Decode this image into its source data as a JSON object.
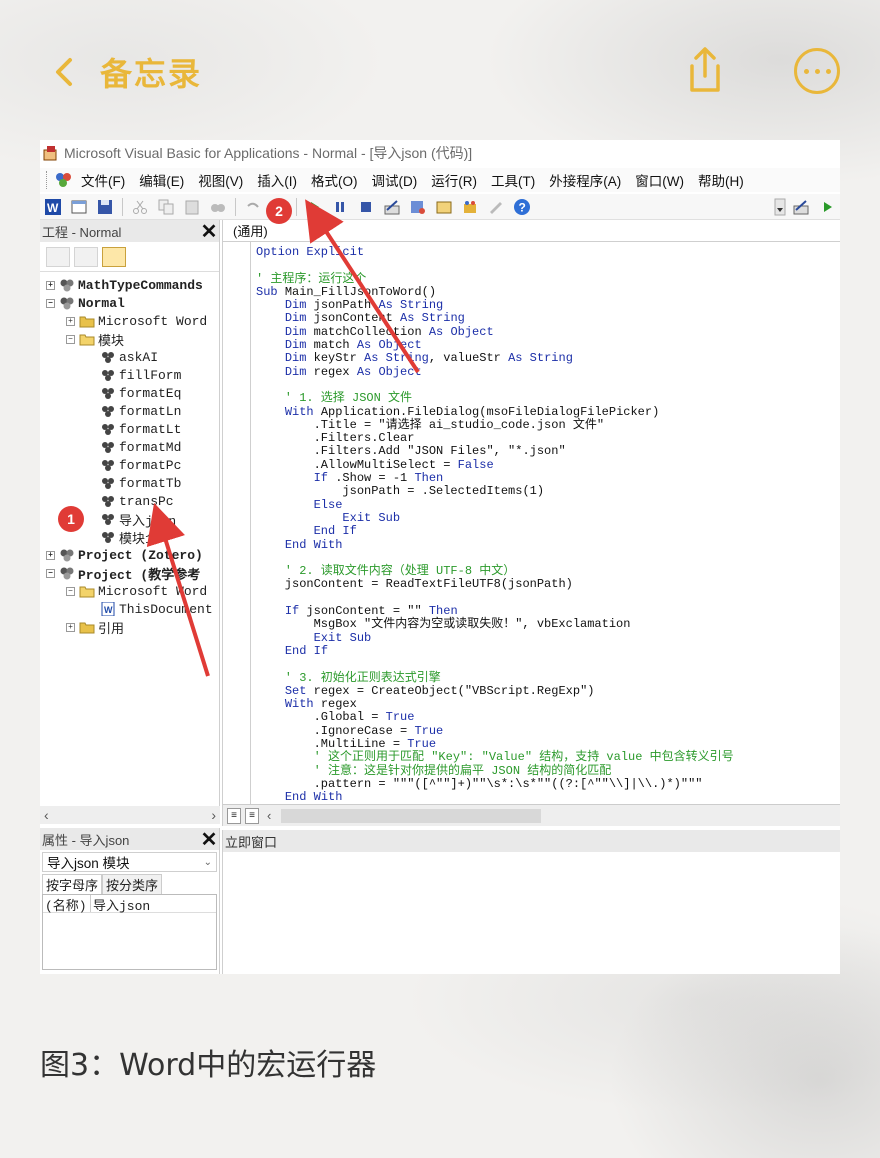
{
  "nav": {
    "back_label": "备忘录",
    "accent_color": "#e9b73a",
    "share_icon": "share-icon",
    "more_icon": "more-icon"
  },
  "vba": {
    "title": "Microsoft Visual Basic for Applications - Normal - [导入json (代码)]",
    "menu": [
      "文件(F)",
      "编辑(E)",
      "视图(V)",
      "插入(I)",
      "格式(O)",
      "调试(D)",
      "运行(R)",
      "工具(T)",
      "外接程序(A)",
      "窗口(W)",
      "帮助(H)"
    ],
    "project_panel": {
      "title": "工程 - Normal",
      "tree": [
        {
          "label": "MathTypeCommands",
          "bold": true
        },
        {
          "label": "Normal",
          "bold": true
        },
        {
          "label": "Microsoft Word",
          "bold": false
        },
        {
          "label": "模块",
          "bold": false
        },
        {
          "label": "askAI"
        },
        {
          "label": "fillForm"
        },
        {
          "label": "formatEq"
        },
        {
          "label": "formatLn"
        },
        {
          "label": "formatLt"
        },
        {
          "label": "formatMd"
        },
        {
          "label": "formatPc"
        },
        {
          "label": "formatTb"
        },
        {
          "label": "transPc"
        },
        {
          "label": "导入json"
        },
        {
          "label": "模块1"
        },
        {
          "label": "Project (Zotero)",
          "bold": true
        },
        {
          "label": "Project (教学参考",
          "bold": true
        },
        {
          "label": "Microsoft Word"
        },
        {
          "label": "ThisDocument"
        },
        {
          "label": "引用"
        }
      ]
    },
    "props_panel": {
      "title": "属性 - 导入json",
      "selected": "导入json 模块",
      "tabs": [
        "按字母序",
        "按分类序"
      ],
      "row_name": "(名称)",
      "row_value": "导入json"
    },
    "code_panel": {
      "combo": "(通用)",
      "lines": [
        [
          {
            "t": "Option Explicit",
            "c": "kw"
          }
        ],
        [
          {
            "t": ""
          }
        ],
        [
          {
            "t": "' 主程序：运行这个",
            "c": "cm"
          }
        ],
        [
          {
            "t": "Sub ",
            "c": "kw"
          },
          {
            "t": "Main_FillJsonToWord()"
          }
        ],
        [
          {
            "t": "    "
          },
          {
            "t": "Dim ",
            "c": "kw"
          },
          {
            "t": "jsonPath "
          },
          {
            "t": "As String",
            "c": "kw"
          }
        ],
        [
          {
            "t": "    "
          },
          {
            "t": "Dim ",
            "c": "kw"
          },
          {
            "t": "jsonContent "
          },
          {
            "t": "As String",
            "c": "kw"
          }
        ],
        [
          {
            "t": "    "
          },
          {
            "t": "Dim ",
            "c": "kw"
          },
          {
            "t": "matchCollection "
          },
          {
            "t": "As Object",
            "c": "kw"
          }
        ],
        [
          {
            "t": "    "
          },
          {
            "t": "Dim ",
            "c": "kw"
          },
          {
            "t": "match "
          },
          {
            "t": "As Object",
            "c": "kw"
          }
        ],
        [
          {
            "t": "    "
          },
          {
            "t": "Dim ",
            "c": "kw"
          },
          {
            "t": "keyStr "
          },
          {
            "t": "As String",
            "c": "kw"
          },
          {
            "t": ", valueStr "
          },
          {
            "t": "As String",
            "c": "kw"
          }
        ],
        [
          {
            "t": "    "
          },
          {
            "t": "Dim ",
            "c": "kw"
          },
          {
            "t": "regex "
          },
          {
            "t": "As Object",
            "c": "kw"
          }
        ],
        [
          {
            "t": ""
          }
        ],
        [
          {
            "t": "    ' 1. 选择 JSON 文件",
            "c": "cm"
          }
        ],
        [
          {
            "t": "    "
          },
          {
            "t": "With ",
            "c": "kw"
          },
          {
            "t": "Application.FileDialog(msoFileDialogFilePicker)"
          }
        ],
        [
          {
            "t": "        .Title = \"请选择 ai_studio_code.json 文件\""
          }
        ],
        [
          {
            "t": "        .Filters.Clear"
          }
        ],
        [
          {
            "t": "        .Filters.Add \"JSON Files\", \"*.json\""
          }
        ],
        [
          {
            "t": "        .AllowMultiSelect = "
          },
          {
            "t": "False",
            "c": "kw"
          }
        ],
        [
          {
            "t": "        "
          },
          {
            "t": "If ",
            "c": "kw"
          },
          {
            "t": ".Show = -1 "
          },
          {
            "t": "Then",
            "c": "kw"
          }
        ],
        [
          {
            "t": "            jsonPath = .SelectedItems(1)"
          }
        ],
        [
          {
            "t": "        "
          },
          {
            "t": "Else",
            "c": "kw"
          }
        ],
        [
          {
            "t": "            "
          },
          {
            "t": "Exit Sub",
            "c": "kw"
          }
        ],
        [
          {
            "t": "        "
          },
          {
            "t": "End If",
            "c": "kw"
          }
        ],
        [
          {
            "t": "    "
          },
          {
            "t": "End With",
            "c": "kw"
          }
        ],
        [
          {
            "t": ""
          }
        ],
        [
          {
            "t": "    ' 2. 读取文件内容（处理 UTF-8 中文）",
            "c": "cm"
          }
        ],
        [
          {
            "t": "    jsonContent = ReadTextFileUTF8(jsonPath)"
          }
        ],
        [
          {
            "t": ""
          }
        ],
        [
          {
            "t": "    "
          },
          {
            "t": "If ",
            "c": "kw"
          },
          {
            "t": "jsonContent = \"\" "
          },
          {
            "t": "Then",
            "c": "kw"
          }
        ],
        [
          {
            "t": "        MsgBox \"文件内容为空或读取失败！\", vbExclamation"
          }
        ],
        [
          {
            "t": "        "
          },
          {
            "t": "Exit Sub",
            "c": "kw"
          }
        ],
        [
          {
            "t": "    "
          },
          {
            "t": "End If",
            "c": "kw"
          }
        ],
        [
          {
            "t": ""
          }
        ],
        [
          {
            "t": "    ' 3. 初始化正则表达式引擎",
            "c": "cm"
          }
        ],
        [
          {
            "t": "    "
          },
          {
            "t": "Set ",
            "c": "kw"
          },
          {
            "t": "regex = CreateObject(\"VBScript.RegExp\")"
          }
        ],
        [
          {
            "t": "    "
          },
          {
            "t": "With ",
            "c": "kw"
          },
          {
            "t": "regex"
          }
        ],
        [
          {
            "t": "        .Global = "
          },
          {
            "t": "True",
            "c": "kw"
          }
        ],
        [
          {
            "t": "        .IgnoreCase = "
          },
          {
            "t": "True",
            "c": "kw"
          }
        ],
        [
          {
            "t": "        .MultiLine = "
          },
          {
            "t": "True",
            "c": "kw"
          }
        ],
        [
          {
            "t": "        ' 这个正则用于匹配 \"Key\": \"Value\" 结构，支持 value 中包含转义引号",
            "c": "cm"
          }
        ],
        [
          {
            "t": "        ' 注意：这是针对你提供的扁平 JSON 结构的简化匹配",
            "c": "cm"
          }
        ],
        [
          {
            "t": "        .pattern = \"\"\"([^\"\"]+)\"\"\\s*:\\s*\"\"((?:[^\"\"\\\\]|\\\\.)*)\"\"\""
          }
        ],
        [
          {
            "t": "    "
          },
          {
            "t": "End With",
            "c": "kw"
          }
        ]
      ]
    },
    "immediate_title": "立即窗口"
  },
  "badges": {
    "one": "1",
    "two": "2"
  },
  "caption": "图3：Word中的宏运行器"
}
